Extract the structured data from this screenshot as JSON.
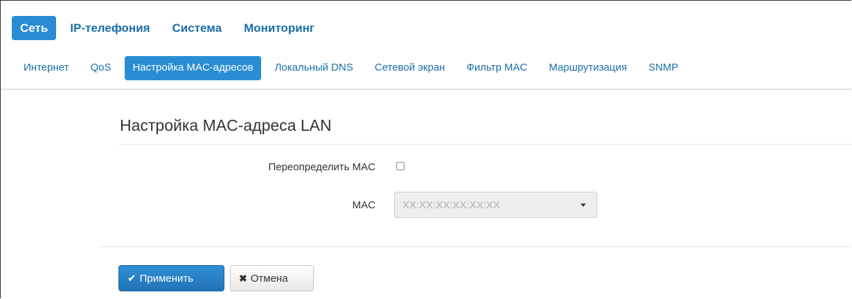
{
  "top_nav": {
    "items": [
      {
        "label": "Сеть"
      },
      {
        "label": "IP-телефония"
      },
      {
        "label": "Система"
      },
      {
        "label": "Мониторинг"
      }
    ]
  },
  "sub_nav": {
    "items": [
      {
        "label": "Интернет"
      },
      {
        "label": "QoS"
      },
      {
        "label": "Настройка MAC-адресов"
      },
      {
        "label": "Локальный DNS"
      },
      {
        "label": "Сетевой экран"
      },
      {
        "label": "Фильтр MAC"
      },
      {
        "label": "Маршрутизация"
      },
      {
        "label": "SNMP"
      }
    ]
  },
  "section": {
    "title": "Настройка MAC-адреса LAN"
  },
  "form": {
    "override_label": "Переопределить MAC",
    "override_checked": false,
    "mac_label": "MAC",
    "mac_placeholder": "XX:XX:XX:XX:XX:XX",
    "mac_value": ""
  },
  "buttons": {
    "apply": "Применить",
    "cancel": "Отмена"
  },
  "icons": {
    "apply": "check-icon",
    "cancel": "times-icon",
    "select_caret": "caret-down-icon"
  },
  "colors": {
    "accent": "#2a8dd3",
    "link": "#1a6ea8",
    "primary_button": "#2174b5"
  }
}
